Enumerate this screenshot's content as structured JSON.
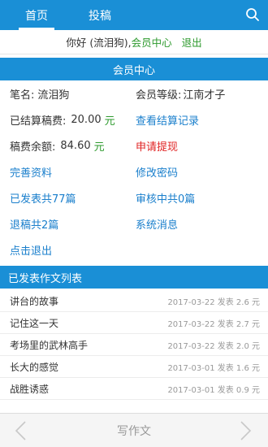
{
  "nav": {
    "tabs": [
      {
        "label": "首页",
        "active": true
      },
      {
        "label": "投稿",
        "active": false
      }
    ],
    "search_icon": "search-icon"
  },
  "welcome": {
    "greeting": "你好 (流泪狗),",
    "member_center": "会员中心",
    "logout": "退出"
  },
  "member": {
    "header": "会员中心",
    "pen_name_label": "笔名:",
    "pen_name": "流泪狗",
    "level_label": "会员等级:",
    "level": "江南才子",
    "settled_label": "已结算稿费:",
    "settled_amount": "20.00",
    "settled_unit": "元",
    "view_settlement": "查看结算记录",
    "balance_label": "稿费余额:",
    "balance_amount": "84.60",
    "balance_unit": "元",
    "withdraw": "申请提现",
    "complete_profile": "完善资料",
    "change_password": "修改密码",
    "published": "已发表共77篇",
    "reviewing": "审核中共0篇",
    "returned": "退稿共2篇",
    "system_message": "系统消息",
    "click_logout": "点击退出"
  },
  "articles": {
    "header": "已发表作文列表",
    "items": [
      {
        "title": "讲台的故事",
        "meta": "2017-03-22 发表 2.6 元"
      },
      {
        "title": "记住这一天",
        "meta": "2017-03-22 发表 2.7 元"
      },
      {
        "title": "考场里的武林高手",
        "meta": "2017-03-22 发表 2.0 元"
      },
      {
        "title": "长大的感觉",
        "meta": "2017-03-01 发表 1.6 元"
      },
      {
        "title": "战胜诱惑",
        "meta": "2017-03-01 发表 0.9 元"
      }
    ]
  },
  "bottom": {
    "write": "写作文"
  },
  "colors": {
    "brand_blue": "#1a8fd6",
    "link_blue": "#1a7fcc",
    "green": "#2e9a2e",
    "red": "#e02222"
  }
}
